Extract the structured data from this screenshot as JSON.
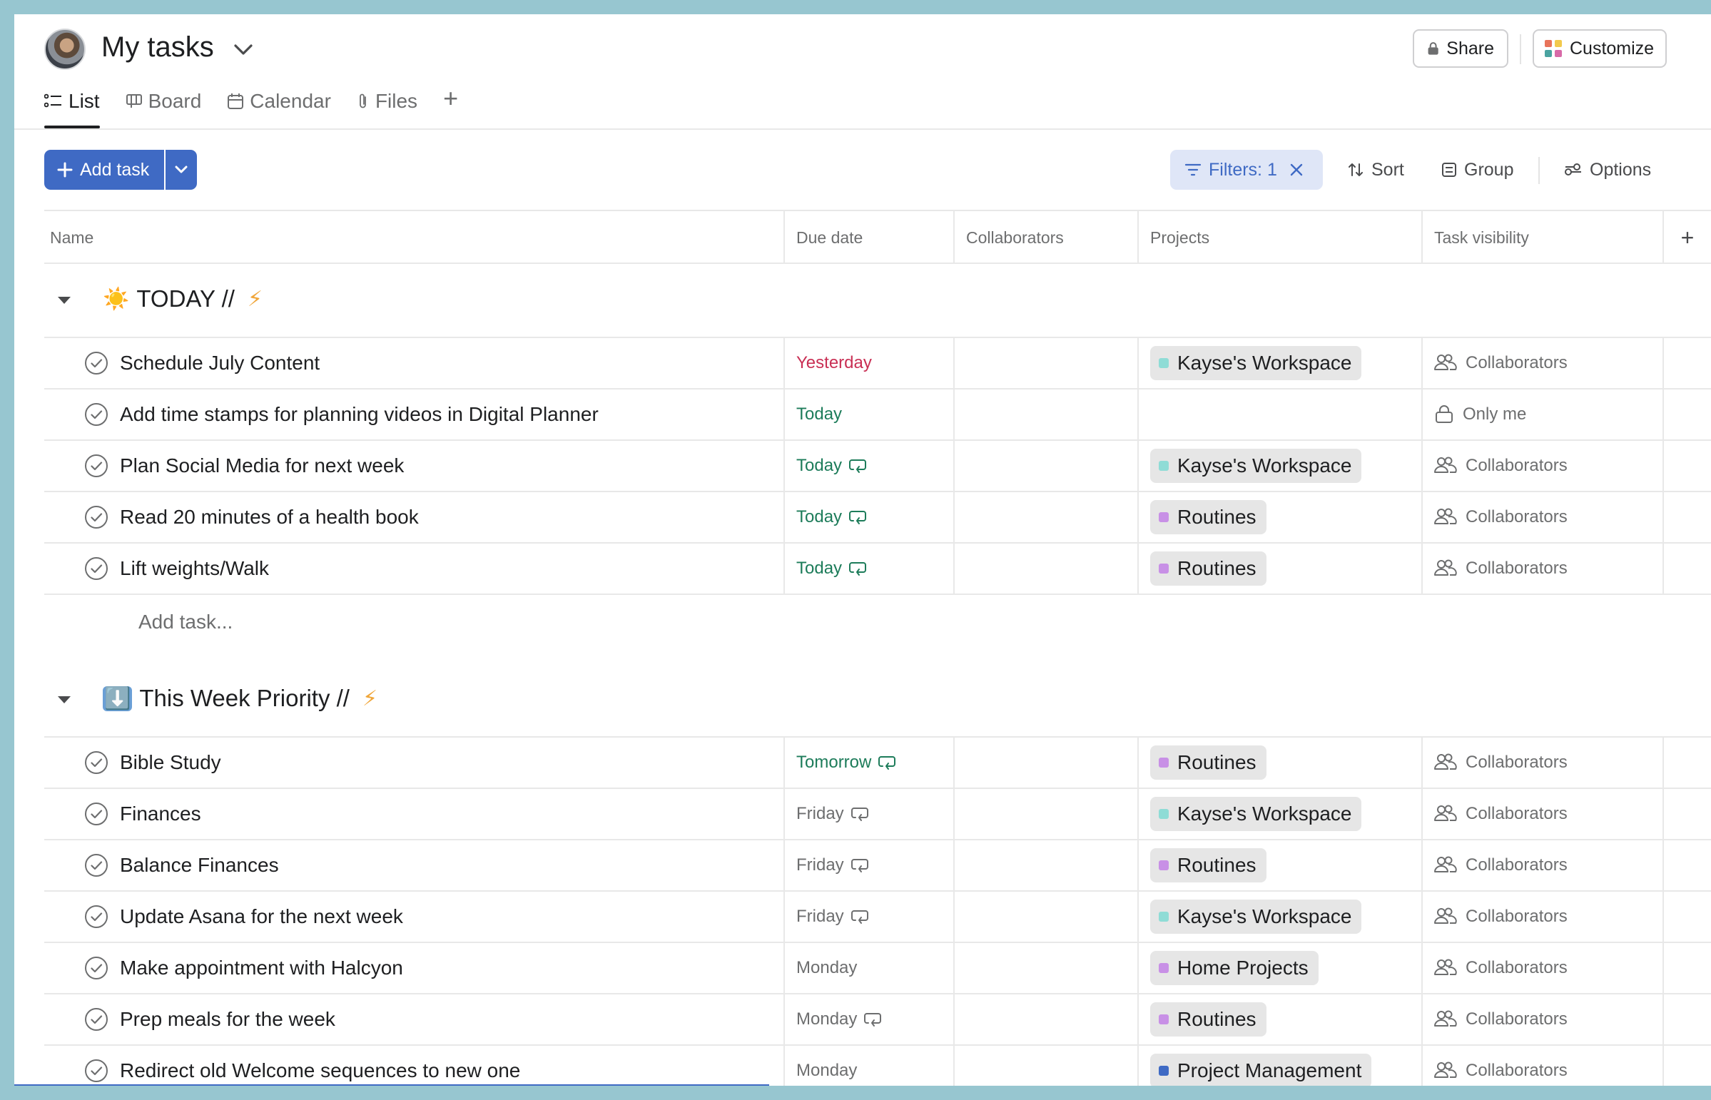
{
  "header": {
    "title": "My tasks",
    "share_label": "Share",
    "customize_label": "Customize",
    "tabs": [
      {
        "label": "List",
        "icon": "list-icon",
        "active": true
      },
      {
        "label": "Board",
        "icon": "board-icon",
        "active": false
      },
      {
        "label": "Calendar",
        "icon": "calendar-icon",
        "active": false
      },
      {
        "label": "Files",
        "icon": "paperclip-icon",
        "active": false
      }
    ]
  },
  "toolbar": {
    "add_task_label": "Add task",
    "filter_label": "Filters: 1",
    "sort_label": "Sort",
    "group_label": "Group",
    "options_label": "Options"
  },
  "columns": {
    "name": "Name",
    "due": "Due date",
    "collaborators": "Collaborators",
    "projects": "Projects",
    "visibility": "Task visibility"
  },
  "colors": {
    "accent": "#3f6ac4",
    "overdue": "#c92f54",
    "due_soon": "#1d7c5a",
    "project_teal": "#8fdcd6",
    "project_purple": "#c890e6",
    "project_blue": "#3f6ac4"
  },
  "sections": [
    {
      "title": "TODAY //",
      "emoji": "☀️",
      "trailing": "⚡",
      "tasks": [
        {
          "name": "Schedule July Content",
          "due": "Yesterday",
          "due_style": "red",
          "recurring": false,
          "project": "Kayse's Workspace",
          "project_color": "#8fdcd6",
          "visibility": "Collaborators",
          "vis_icon": "people-icon"
        },
        {
          "name": "Add time stamps for planning videos in Digital Planner",
          "due": "Today",
          "due_style": "green",
          "recurring": false,
          "project": "",
          "project_color": "",
          "visibility": "Only me",
          "vis_icon": "lock-icon"
        },
        {
          "name": "Plan Social Media for next week",
          "due": "Today",
          "due_style": "green",
          "recurring": true,
          "project": "Kayse's Workspace",
          "project_color": "#8fdcd6",
          "visibility": "Collaborators",
          "vis_icon": "people-icon"
        },
        {
          "name": "Read 20 minutes of a health book",
          "due": "Today",
          "due_style": "green",
          "recurring": true,
          "project": "Routines",
          "project_color": "#c890e6",
          "visibility": "Collaborators",
          "vis_icon": "people-icon"
        },
        {
          "name": "Lift weights/Walk",
          "due": "Today",
          "due_style": "green",
          "recurring": true,
          "project": "Routines",
          "project_color": "#c890e6",
          "visibility": "Collaborators",
          "vis_icon": "people-icon"
        }
      ],
      "add_task_label": "Add task..."
    },
    {
      "title": "This Week Priority //",
      "emoji": "⬇️",
      "trailing": "⚡",
      "tasks": [
        {
          "name": "Bible Study",
          "due": "Tomorrow",
          "due_style": "green",
          "recurring": true,
          "project": "Routines",
          "project_color": "#c890e6",
          "visibility": "Collaborators",
          "vis_icon": "people-icon"
        },
        {
          "name": "Finances",
          "due": "Friday",
          "due_style": "gray",
          "recurring": true,
          "project": "Kayse's Workspace",
          "project_color": "#8fdcd6",
          "visibility": "Collaborators",
          "vis_icon": "people-icon"
        },
        {
          "name": "Balance Finances",
          "due": "Friday",
          "due_style": "gray",
          "recurring": true,
          "project": "Routines",
          "project_color": "#c890e6",
          "visibility": "Collaborators",
          "vis_icon": "people-icon"
        },
        {
          "name": "Update Asana for the next week",
          "due": "Friday",
          "due_style": "gray",
          "recurring": true,
          "project": "Kayse's Workspace",
          "project_color": "#8fdcd6",
          "visibility": "Collaborators",
          "vis_icon": "people-icon"
        },
        {
          "name": "Make appointment with Halcyon",
          "due": "Monday",
          "due_style": "gray",
          "recurring": false,
          "project": "Home Projects",
          "project_color": "#c890e6",
          "visibility": "Collaborators",
          "vis_icon": "people-icon"
        },
        {
          "name": "Prep meals for the week",
          "due": "Monday",
          "due_style": "gray",
          "recurring": true,
          "project": "Routines",
          "project_color": "#c890e6",
          "visibility": "Collaborators",
          "vis_icon": "people-icon"
        },
        {
          "name": "Redirect old Welcome sequences to new one",
          "due": "Monday",
          "due_style": "gray",
          "recurring": false,
          "project": "Project Management",
          "project_color": "#3f6ac4",
          "visibility": "Collaborators",
          "vis_icon": "people-icon"
        }
      ]
    }
  ]
}
